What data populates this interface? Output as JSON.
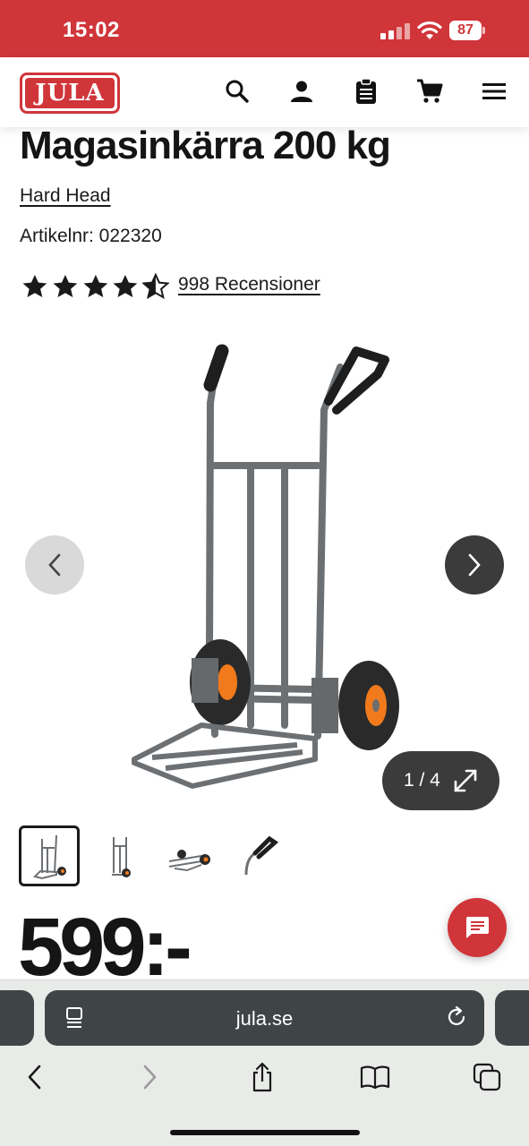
{
  "status_bar": {
    "time": "15:02",
    "battery": "87"
  },
  "header": {
    "logo_text": "JULA",
    "icons": [
      "search-icon",
      "account-icon",
      "shopping-list-icon",
      "cart-icon",
      "menu-icon"
    ]
  },
  "product": {
    "title": "Magasinkärra 200 kg",
    "brand": "Hard Head",
    "article_number": "Artikelnr: 022320",
    "rating": 4.5,
    "reviews_label": "998 Recensioner",
    "price": "599:-"
  },
  "gallery": {
    "counter": "1 / 4",
    "thumbnail_count": 4,
    "active_index": 0
  },
  "browser": {
    "url": "jula.se"
  },
  "colors": {
    "brand_red": "#d0353a",
    "dark_button": "#3b3b3b",
    "orange_hub": "#f07a1c"
  }
}
